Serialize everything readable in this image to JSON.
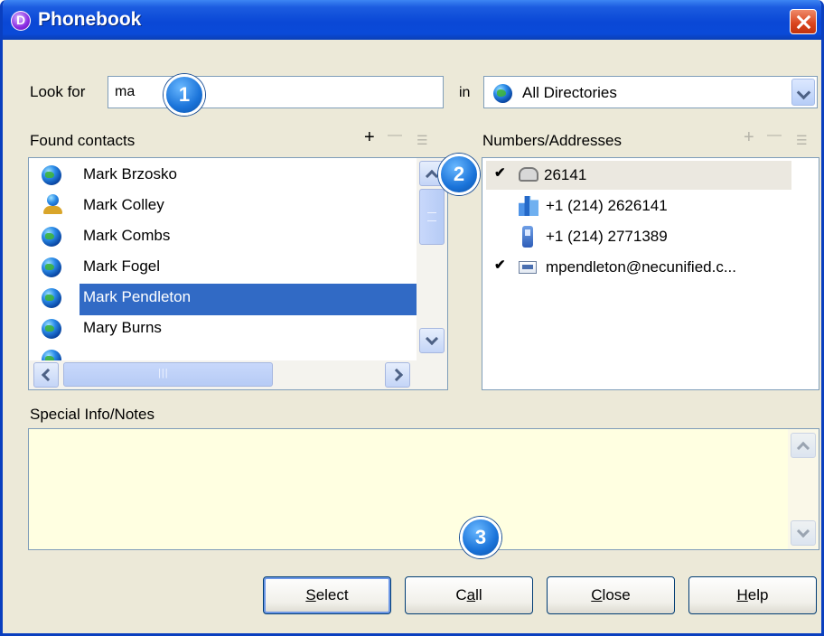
{
  "window": {
    "title": "Phonebook",
    "app_icon_letter": "D"
  },
  "search": {
    "label": "Look for",
    "value": "ma",
    "in_label": "in",
    "directory": "All Directories"
  },
  "contacts": {
    "label": "Found contacts",
    "add_symbol": "+",
    "remove_symbol": "—",
    "details_symbol": "☰",
    "items": [
      {
        "name": "Mark Brzosko",
        "icon": "globe-icon"
      },
      {
        "name": "Mark Colley",
        "icon": "person-icon"
      },
      {
        "name": "Mark Combs",
        "icon": "globe-icon"
      },
      {
        "name": "Mark Fogel",
        "icon": "globe-icon"
      },
      {
        "name": "Mark Pendleton",
        "icon": "globe-icon",
        "selected": true
      },
      {
        "name": "Mary Burns",
        "icon": "globe-icon"
      }
    ]
  },
  "numbers": {
    "label": "Numbers/Addresses",
    "add_symbol": "+",
    "remove_symbol": "—",
    "details_symbol": "☰",
    "check_symbol": "✔",
    "items": [
      {
        "value": "26141",
        "icon": "phone-icon",
        "checked": true
      },
      {
        "value": "+1 (214) 2626141",
        "icon": "building-icon",
        "checked": false
      },
      {
        "value": "+1 (214) 2771389",
        "icon": "mobile-icon",
        "checked": false
      },
      {
        "value": "mpendleton@necunified.c...",
        "icon": "email-icon",
        "checked": true
      }
    ]
  },
  "notes": {
    "label": "Special Info/Notes",
    "value": ""
  },
  "buttons": {
    "select": {
      "underline": "S",
      "rest": "elect"
    },
    "call": {
      "pre": "C",
      "underline": "a",
      "rest": "ll"
    },
    "close": {
      "underline": "C",
      "rest": "lose"
    },
    "help": {
      "underline": "H",
      "rest": "elp"
    }
  },
  "badges": [
    "1",
    "2",
    "3"
  ]
}
